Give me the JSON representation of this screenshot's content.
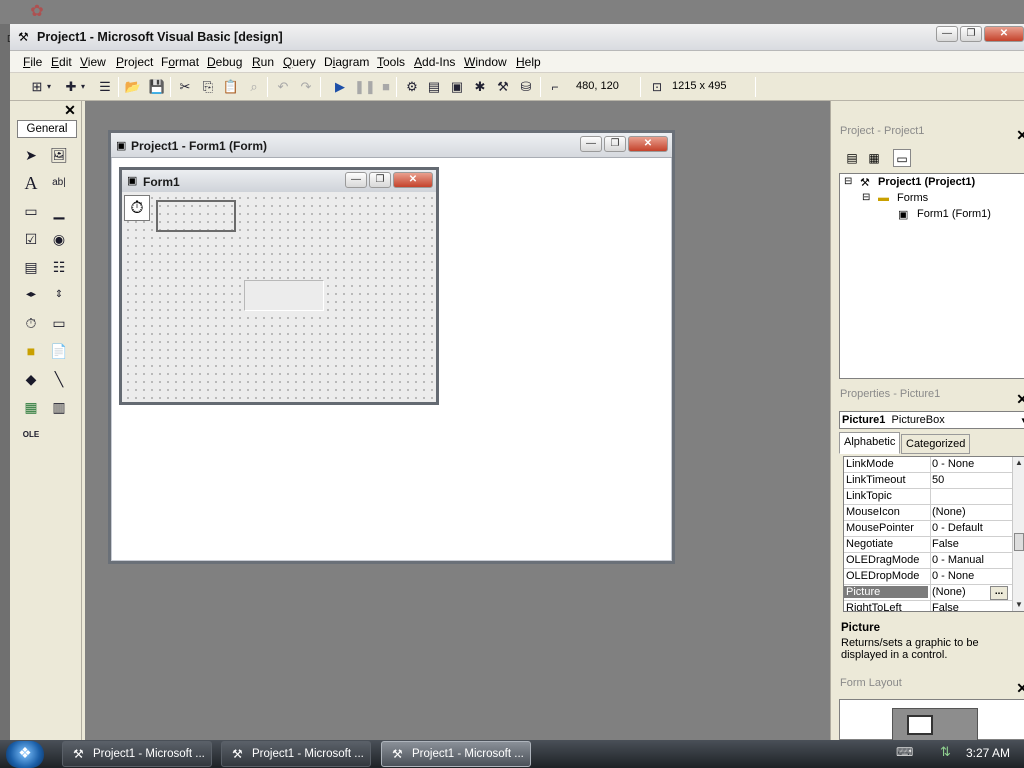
{
  "window": {
    "title": "Project1 - Microsoft Visual Basic [design]",
    "min": "—",
    "max": "❐",
    "close": "✕"
  },
  "menu": {
    "items": [
      {
        "u": "F",
        "rest": "ile"
      },
      {
        "u": "E",
        "rest": "dit"
      },
      {
        "u": "V",
        "rest": "iew"
      },
      {
        "u": "P",
        "rest": "roject"
      },
      {
        "pre": "F",
        "u": "o",
        "rest": "rmat"
      },
      {
        "u": "D",
        "rest": "ebug"
      },
      {
        "u": "R",
        "rest": "un"
      },
      {
        "u": "Q",
        "rest": "uery"
      },
      {
        "pre": "D",
        "u": "i",
        "rest": "agram"
      },
      {
        "u": "T",
        "rest": "ools"
      },
      {
        "u": "A",
        "rest": "dd-Ins"
      },
      {
        "u": "W",
        "rest": "indow"
      },
      {
        "u": "H",
        "rest": "elp"
      }
    ]
  },
  "toolbar": {
    "position": "480, 120",
    "size": "1215 x 495"
  },
  "toolbox": {
    "close": "✕",
    "tab": "General"
  },
  "designer": {
    "title": "Project1 - Form1 (Form)",
    "form_caption": "Form1"
  },
  "project_pane": {
    "header": "Project - Project1",
    "root": "Project1 (Project1)",
    "folder": "Forms",
    "form_item": "Form1 (Form1)"
  },
  "properties_pane": {
    "header": "Properties - Picture1",
    "object_name": "Picture1",
    "object_type": "PictureBox",
    "tab_alpha": "Alphabetic",
    "tab_cat": "Categorized",
    "rows": [
      {
        "name": "LinkMode",
        "value": "0 - None"
      },
      {
        "name": "LinkTimeout",
        "value": "50"
      },
      {
        "name": "LinkTopic",
        "value": ""
      },
      {
        "name": "MouseIcon",
        "value": "(None)"
      },
      {
        "name": "MousePointer",
        "value": "0 - Default"
      },
      {
        "name": "Negotiate",
        "value": "False"
      },
      {
        "name": "OLEDragMode",
        "value": "0 - Manual"
      },
      {
        "name": "OLEDropMode",
        "value": "0 - None"
      },
      {
        "name": "Picture",
        "value": "(None)"
      },
      {
        "name": "RightToLeft",
        "value": "False"
      }
    ],
    "selected_row": "Picture",
    "desc_title": "Picture",
    "desc_body": "Returns/sets a graphic to be displayed in a control."
  },
  "form_layout_pane": {
    "header": "Form Layout"
  },
  "taskbar": {
    "tasks": [
      {
        "label": "Project1 - Microsoft ..."
      },
      {
        "label": "Project1 - Microsoft ..."
      },
      {
        "label": "Project1 - Microsoft ..."
      }
    ],
    "clock": "3:27 AM"
  }
}
